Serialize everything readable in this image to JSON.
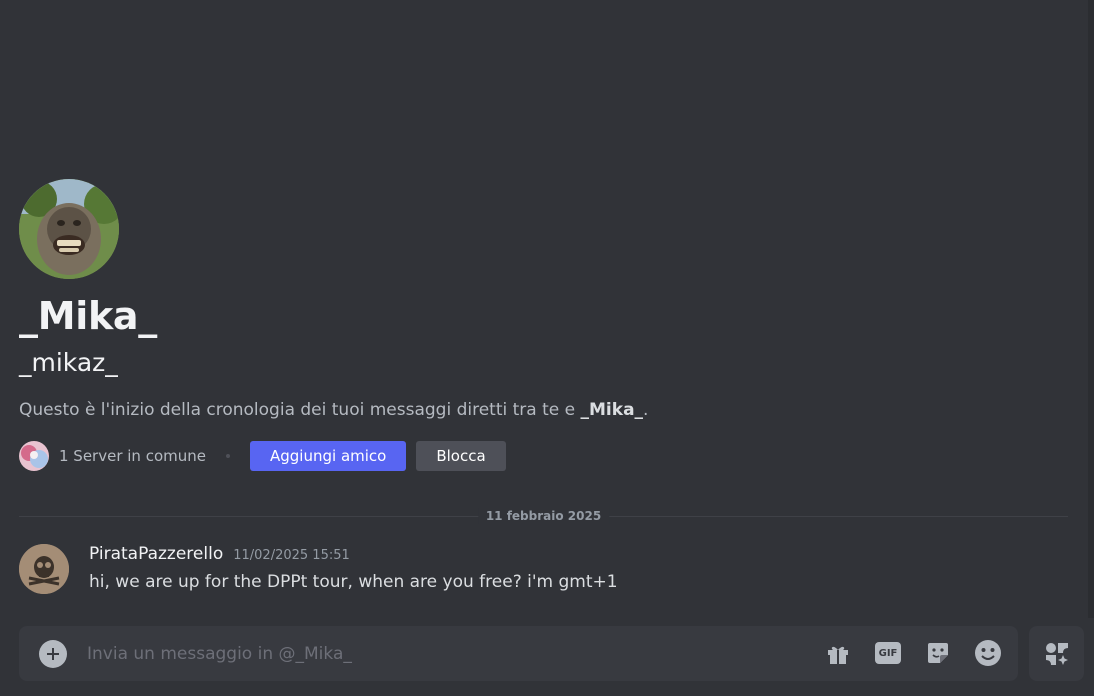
{
  "profile": {
    "display_name": "_Mika_",
    "username": "_mikaz_",
    "intro_prefix": "Questo è l'inizio della cronologia dei tuoi messaggi diretti tra te e ",
    "intro_name": "_Mika_",
    "intro_suffix": "."
  },
  "actions": {
    "mutual_servers": "1 Server in comune",
    "add_friend_label": "Aggiungi amico",
    "block_label": "Blocca"
  },
  "divider": {
    "date": "11 febbraio 2025"
  },
  "messages": [
    {
      "author": "PirataPazzerello",
      "timestamp": "11/02/2025 15:51",
      "content": "hi, we are up for the DPPt tour, when are you free? i'm gmt+1"
    }
  ],
  "composer": {
    "placeholder": "Invia un messaggio in @_Mika_",
    "gif_label": "GIF",
    "icons": [
      "plus-circle-icon",
      "gift-icon",
      "gif-icon",
      "sticker-icon",
      "emoji-icon",
      "apps-icon"
    ]
  },
  "colors": {
    "background": "#313338",
    "composer": "#383a40",
    "primary_button": "#5865f2",
    "secondary_button": "#4e5058"
  }
}
